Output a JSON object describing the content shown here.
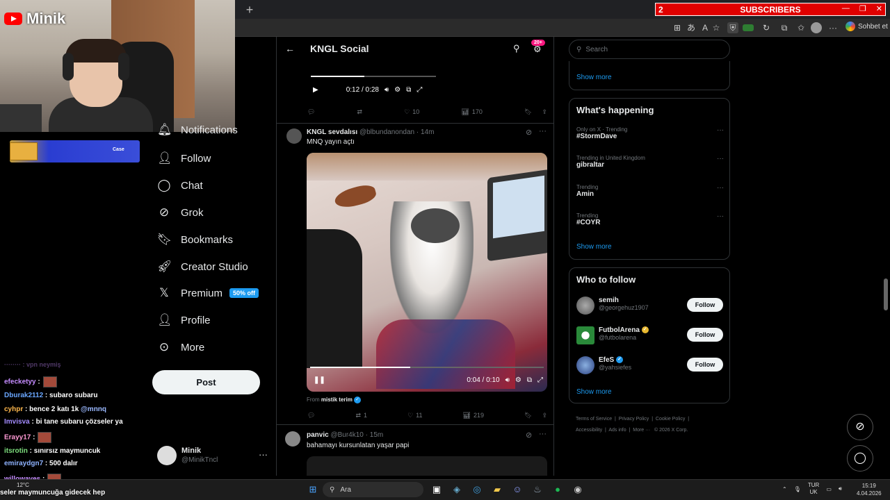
{
  "stream": {
    "brand": "Minik",
    "subs_count": "2",
    "subs_label": "SUBSCRIBERS",
    "sponsor_text": "Case"
  },
  "browser": {
    "newtab": "+",
    "copilot_label": "Sohbet et"
  },
  "nav": {
    "items": [
      {
        "label": "Notifications",
        "icon": "bell-icon"
      },
      {
        "label": "Follow",
        "icon": "person-plus-icon"
      },
      {
        "label": "Chat",
        "icon": "chat-icon"
      },
      {
        "label": "Grok",
        "icon": "grok-icon"
      },
      {
        "label": "Bookmarks",
        "icon": "bookmark-icon"
      },
      {
        "label": "Creator Studio",
        "icon": "rocket-icon"
      },
      {
        "label": "Premium",
        "icon": "x-logo-icon"
      },
      {
        "label": "Profile",
        "icon": "person-icon"
      },
      {
        "label": "More",
        "icon": "more-circle-icon"
      }
    ],
    "premium_badge": "50% off",
    "post_button": "Post"
  },
  "account": {
    "name": "Minik",
    "handle": "@MinikTncl"
  },
  "header": {
    "title": "KNGL Social",
    "notif_badge": "20+"
  },
  "tweet1": {
    "video_time": "0:12 / 0:28",
    "video_progress": 0.43,
    "replies": "",
    "retweets": "",
    "likes": "10",
    "views": "170"
  },
  "tweet2": {
    "name": "KNGL sevdalısı",
    "handle": "@blbundanondan",
    "time": "· 14m",
    "text": "MNQ yayın açtı",
    "video_time": "0:04 / 0:10",
    "video_progress": 0.43,
    "from_label": "From",
    "from_name": "mistik terim",
    "replies": "",
    "retweets": "1",
    "likes": "11",
    "views": "219"
  },
  "tweet3": {
    "name": "panvic",
    "handle": "@Bur4k10",
    "time": "· 15m",
    "text": "bahamayı kursunlatan yaşar papi"
  },
  "right": {
    "search_placeholder": "Search",
    "show_more": "Show more",
    "happening_title": "What's happening",
    "trends": [
      {
        "meta": "Only on X · Trending",
        "name": "#StormDave"
      },
      {
        "meta": "Trending in United Kingdom",
        "name": "gibraltar"
      },
      {
        "meta": "Trending",
        "name": "Amin"
      },
      {
        "meta": "Trending",
        "name": "#COYR"
      }
    ],
    "who_title": "Who to follow",
    "who": [
      {
        "name": "semih",
        "handle": "@georgehuz1907",
        "verified": ""
      },
      {
        "name": "FutbolArena",
        "handle": "@futbolarena",
        "verified": "gold"
      },
      {
        "name": "EfeS",
        "handle": "@yahsiefes",
        "verified": "blue"
      }
    ],
    "follow_label": "Follow",
    "footer_line1": [
      "Terms of Service",
      "Privacy Policy",
      "Cookie Policy"
    ],
    "footer_line2": [
      "Accessibility",
      "Ads info",
      "More ···",
      "© 2026 X Corp."
    ]
  },
  "chat": [
    {
      "user": "efecketyy",
      "msg": " :",
      "color": "#c58cff",
      "emote": true
    },
    {
      "user": "Dburak2112",
      "msg": " : subaro subaru",
      "color": "#6aa7ff",
      "emote": false
    },
    {
      "user": "cyhpr",
      "msg": " : bence 2 katı 1k",
      "mention": " @mnnq",
      "color": "#ffb84d",
      "emote": false
    },
    {
      "user": "Imvisva",
      "msg": " : bi tane subaru çözseler ya",
      "color": "#a48cff",
      "emote": false
    },
    {
      "user": "Erayy17",
      "msg": " :",
      "color": "#ff9ad5",
      "emote": true
    },
    {
      "user": "itsrotin",
      "msg": " : sınırsız maymuncuk",
      "color": "#7fe07f",
      "emote": false
    },
    {
      "user": "emiraydgn7",
      "msg": " : 500 dalır",
      "color": "#8fb3ff",
      "emote": false
    },
    {
      "user": "willowaves",
      "msg": " :",
      "color": "#c58cff",
      "emote": true
    }
  ],
  "chat_bottom": "seler maymuncuğa gidecek hep",
  "weather": "12°C",
  "taskbar": {
    "search": "Ara",
    "lang1": "TUR",
    "lang2": "UK",
    "time": "15:19",
    "date": "4.04.2026"
  }
}
